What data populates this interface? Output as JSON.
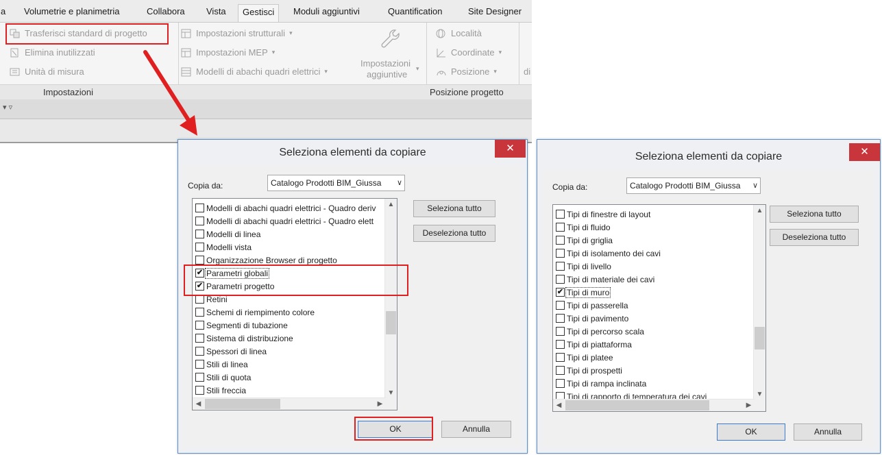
{
  "ribbon": {
    "tabs": [
      "a",
      "Volumetrie e planimetria",
      "Collabora",
      "Vista",
      "Gestisci",
      "Moduli aggiuntivi",
      "Quantification",
      "Site Designer"
    ],
    "active_tab": "Gestisci",
    "buttons": {
      "transfer": "Trasferisci standard di progetto",
      "purge": "Elimina inutilizzati",
      "units": "Unità di misura",
      "structural": "Impostazioni strutturali",
      "mep": "Impostazioni MEP",
      "panel_templates": "Modelli di abachi quadri elettrici",
      "additional_1": "Impostazioni",
      "additional_2": "aggiuntive",
      "location": "Località",
      "coordinates": "Coordinate",
      "position": "Posizione",
      "cut_text": "di"
    },
    "panels": {
      "settings": "Impostazioni",
      "project_location": "Posizione progetto"
    },
    "qat_glyph": "▾ ▿"
  },
  "dialog_left": {
    "title": "Seleziona elementi da copiare",
    "close": "✕",
    "copy_from_label": "Copia da:",
    "source": "Catalogo Prodotti BIM_Giussa",
    "select_all": "Seleziona tutto",
    "deselect_all": "Deseleziona tutto",
    "ok": "OK",
    "cancel": "Annulla",
    "items": [
      {
        "label": "Modelli di abachi quadri elettrici - Quadro deriv",
        "checked": false
      },
      {
        "label": "Modelli di abachi quadri elettrici - Quadro elett",
        "checked": false
      },
      {
        "label": "Modelli di linea",
        "checked": false
      },
      {
        "label": "Modelli vista",
        "checked": false
      },
      {
        "label": "Organizzazione Browser di progetto",
        "checked": false
      },
      {
        "label": "Parametri globali",
        "checked": true
      },
      {
        "label": "Parametri progetto",
        "checked": true
      },
      {
        "label": "Retini",
        "checked": false
      },
      {
        "label": "Schemi di riempimento colore",
        "checked": false
      },
      {
        "label": "Segmenti di tubazione",
        "checked": false
      },
      {
        "label": "Sistema di distribuzione",
        "checked": false
      },
      {
        "label": "Spessori di linea",
        "checked": false
      },
      {
        "label": "Stili di linea",
        "checked": false
      },
      {
        "label": "Stili di quota",
        "checked": false
      },
      {
        "label": "Stili freccia",
        "checked": false
      }
    ]
  },
  "dialog_right": {
    "title": "Seleziona elementi da copiare",
    "close": "✕",
    "copy_from_label": "Copia da:",
    "source": "Catalogo Prodotti BIM_Giussa",
    "select_all": "Seleziona tutto",
    "deselect_all": "Deseleziona tutto",
    "ok": "OK",
    "cancel": "Annulla",
    "items": [
      {
        "label": "Tipi di finestre di layout",
        "checked": false
      },
      {
        "label": "Tipi di fluido",
        "checked": false
      },
      {
        "label": "Tipi di griglia",
        "checked": false
      },
      {
        "label": "Tipi di isolamento dei cavi",
        "checked": false
      },
      {
        "label": "Tipi di livello",
        "checked": false
      },
      {
        "label": "Tipi di materiale dei cavi",
        "checked": false
      },
      {
        "label": "Tipi di muro",
        "checked": true
      },
      {
        "label": "Tipi di passerella",
        "checked": false
      },
      {
        "label": "Tipi di pavimento",
        "checked": false
      },
      {
        "label": "Tipi di percorso scala",
        "checked": false
      },
      {
        "label": "Tipi di piattaforma",
        "checked": false
      },
      {
        "label": "Tipi di platee",
        "checked": false
      },
      {
        "label": "Tipi di prospetti",
        "checked": false
      },
      {
        "label": "Tipi di rampa inclinata",
        "checked": false
      },
      {
        "label": "Tipi di rapporto di temperatura dei cavi",
        "checked": false
      }
    ]
  },
  "glyphs": {
    "check": "✔",
    "scroll_up": "▲",
    "scroll_down": "▼",
    "scroll_left": "◀",
    "scroll_right": "▶",
    "combo_arrow": "∨",
    "caret": "▾"
  },
  "colors": {
    "highlight": "#e02020",
    "close_button": "#c8353b",
    "dialog_border": "#5b8fc7"
  }
}
